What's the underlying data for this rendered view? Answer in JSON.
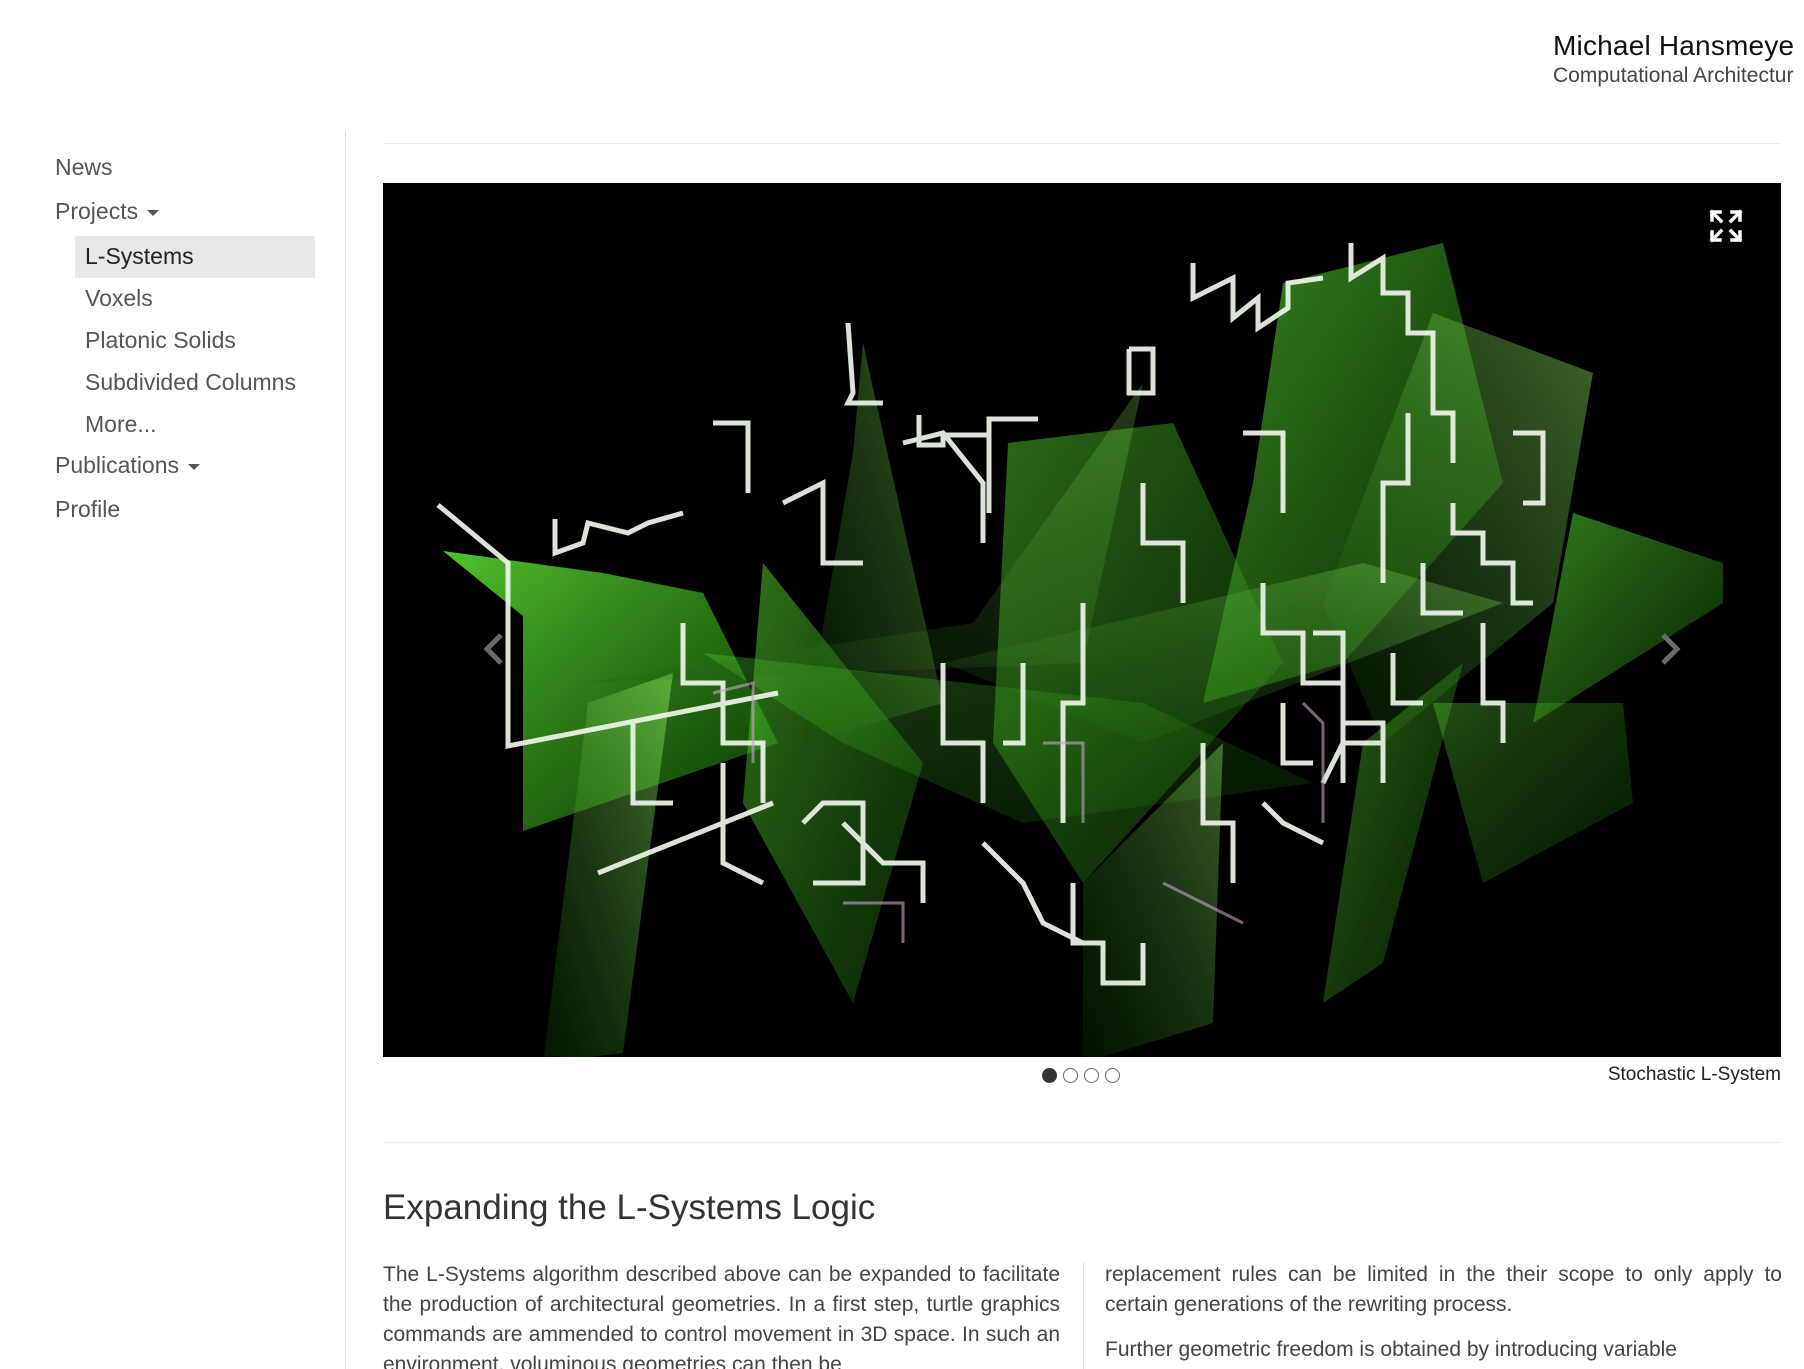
{
  "brand": {
    "name": "Michael Hansmeye",
    "subtitle": "Computational Architectur"
  },
  "sidebar": {
    "items": [
      {
        "label": "News"
      },
      {
        "label": "Projects",
        "has_caret": true
      },
      {
        "label": "Publications",
        "has_caret": true
      },
      {
        "label": "Profile"
      }
    ],
    "projects_sub": [
      {
        "label": "L-Systems",
        "active": true
      },
      {
        "label": "Voxels"
      },
      {
        "label": "Platonic Solids"
      },
      {
        "label": "Subdivided Columns"
      },
      {
        "label": "More..."
      }
    ]
  },
  "carousel": {
    "image_alt": "Stochastic L-System",
    "caption": "Stochastic L-System",
    "slide_count": 4,
    "active_slide": 1,
    "expand_icon": "expand-icon",
    "prev_icon": "chevron-left-icon",
    "next_icon": "chevron-right-icon"
  },
  "section": {
    "title": "Expanding the L-Systems Logic",
    "col_left": [
      "The L-Systems algorithm described above can be expanded to facilitate the production of architectural geometries. In a first step, turtle graphics commands are ammended to control movement in 3D space. In such an environment, voluminous geometries can then be"
    ],
    "col_right": [
      "replacement rules can be limited in the their scope to only apply to certain generations of the rewriting process.",
      "Further geometric freedom is obtained by introducing variable"
    ]
  },
  "colors": {
    "accent_green": "#3cc81c",
    "active_nav_bg": "#e8e8e8"
  }
}
